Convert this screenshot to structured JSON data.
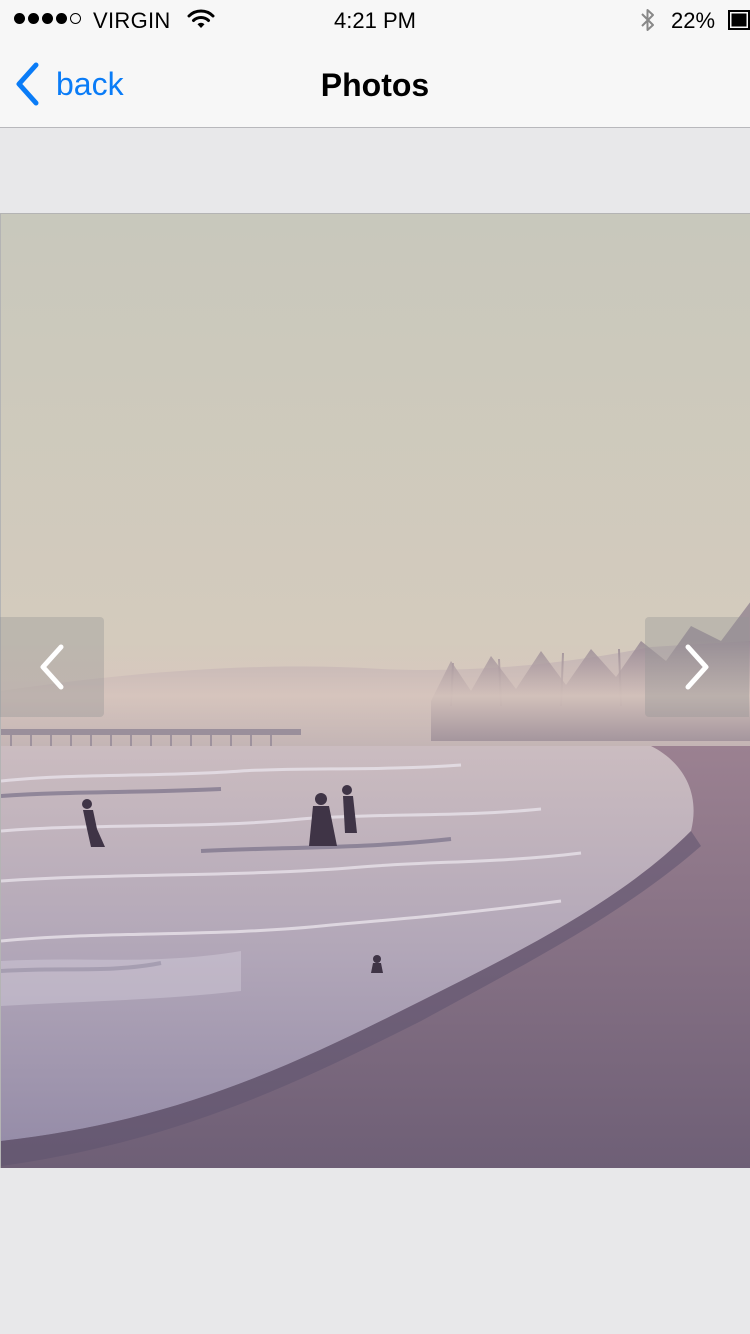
{
  "status_bar": {
    "carrier": "VIRGIN",
    "time": "4:21 PM",
    "battery_percent": "22%",
    "signal_bars_filled": 4,
    "signal_bars_total": 5,
    "icons": [
      "signal-dots-icon",
      "wifi-icon",
      "bluetooth-icon",
      "battery-icon"
    ]
  },
  "nav": {
    "back_label": "back",
    "title": "Photos",
    "icons": [
      "chevron-left-icon"
    ]
  },
  "photo_viewer": {
    "icons": [
      "previous-arrow-icon",
      "next-arrow-icon"
    ]
  },
  "colors": {
    "accent": "#0a7cf7",
    "background": "#e8e8ea",
    "bar_background": "#f7f7f7"
  }
}
